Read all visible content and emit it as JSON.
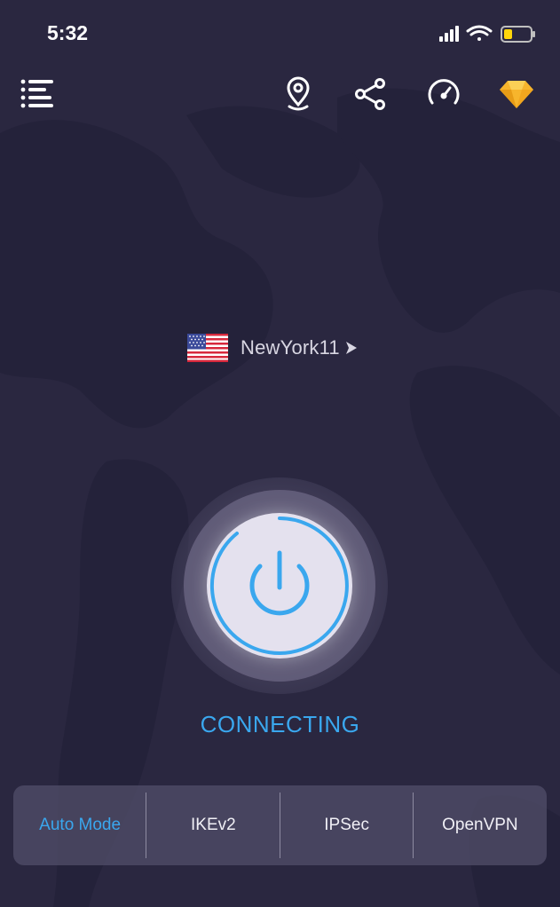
{
  "status_bar": {
    "time": "5:32"
  },
  "toolbar": {
    "icons": [
      "menu-icon",
      "location-pin-icon",
      "share-icon",
      "speedometer-icon",
      "diamond-icon"
    ]
  },
  "server": {
    "name": "NewYork11",
    "flag": "us-flag-icon"
  },
  "connection": {
    "status": "CONNECTING"
  },
  "protocols": {
    "tabs": [
      {
        "label": "Auto Mode",
        "active": true
      },
      {
        "label": "IKEv2",
        "active": false
      },
      {
        "label": "IPSec",
        "active": false
      },
      {
        "label": "OpenVPN",
        "active": false
      }
    ]
  },
  "colors": {
    "background": "#2a2740",
    "accent": "#3aa7ee",
    "premium": "#f7b52c"
  }
}
